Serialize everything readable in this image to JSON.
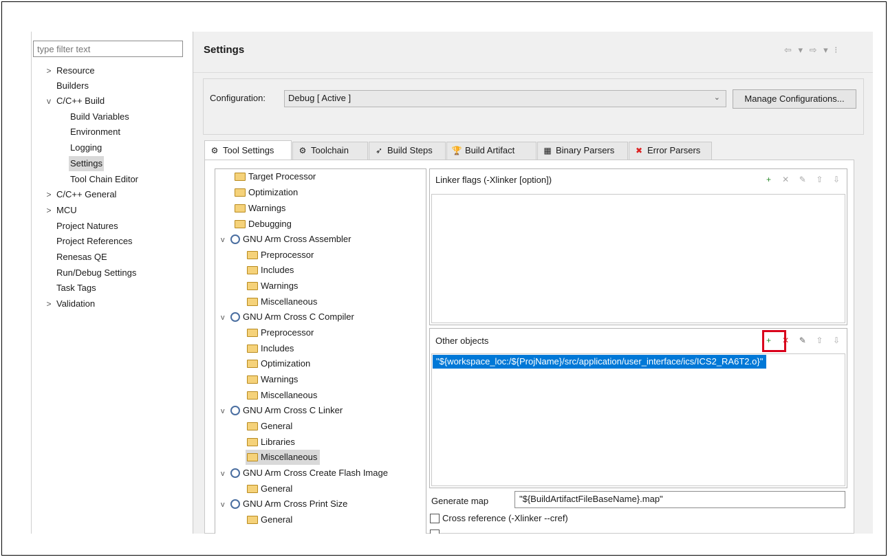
{
  "filter": {
    "placeholder": "type filter text"
  },
  "nav": {
    "items": [
      {
        "label": "Resource",
        "chevron": ">"
      },
      {
        "label": "Builders"
      },
      {
        "label": "C/C++ Build",
        "chevron": "v"
      },
      {
        "label": "Build Variables"
      },
      {
        "label": "Environment"
      },
      {
        "label": "Logging"
      },
      {
        "label": "Settings"
      },
      {
        "label": "Tool Chain Editor"
      },
      {
        "label": "C/C++ General",
        "chevron": ">"
      },
      {
        "label": "MCU",
        "chevron": ">"
      },
      {
        "label": "Project Natures"
      },
      {
        "label": "Project References"
      },
      {
        "label": "Renesas QE"
      },
      {
        "label": "Run/Debug Settings"
      },
      {
        "label": "Task Tags"
      },
      {
        "label": "Validation",
        "chevron": ">"
      }
    ]
  },
  "header": {
    "title": "Settings",
    "arrows": "⇦ ▾ ⇨ ▾ ⁝"
  },
  "config": {
    "label": "Configuration:",
    "value": "Debug  [ Active ]",
    "arrow": "⌄",
    "manage": "Manage Configurations..."
  },
  "tabs": [
    {
      "label": "Tool Settings",
      "icon": "⚙"
    },
    {
      "label": "Toolchain",
      "icon": "⚙"
    },
    {
      "label": "Build Steps",
      "icon": "➶"
    },
    {
      "label": "Build Artifact",
      "icon": "🏆"
    },
    {
      "label": "Binary Parsers",
      "icon": "▦"
    },
    {
      "label": "Error Parsers",
      "icon": "✖"
    }
  ],
  "tool_tree": [
    {
      "label": "Target Processor"
    },
    {
      "label": "Optimization"
    },
    {
      "label": "Warnings"
    },
    {
      "label": "Debugging"
    },
    {
      "label": "GNU Arm Cross Assembler",
      "tw": "v"
    },
    {
      "label": "Preprocessor"
    },
    {
      "label": "Includes"
    },
    {
      "label": "Warnings"
    },
    {
      "label": "Miscellaneous"
    },
    {
      "label": "GNU Arm Cross C Compiler",
      "tw": "v"
    },
    {
      "label": "Preprocessor"
    },
    {
      "label": "Includes"
    },
    {
      "label": "Optimization"
    },
    {
      "label": "Warnings"
    },
    {
      "label": "Miscellaneous"
    },
    {
      "label": "GNU Arm Cross C Linker",
      "tw": "v"
    },
    {
      "label": "General"
    },
    {
      "label": "Libraries"
    },
    {
      "label": "Miscellaneous"
    },
    {
      "label": "GNU Arm Cross Create Flash Image",
      "tw": "v"
    },
    {
      "label": "General"
    },
    {
      "label": "GNU Arm Cross Print Size",
      "tw": "v"
    },
    {
      "label": "General"
    }
  ],
  "linker_flags": {
    "title": "Linker flags (-Xlinker [option])"
  },
  "other_objects": {
    "title": "Other objects",
    "entry": "\"${workspace_loc:/${ProjName}/src/application/user_interface/ics/ICS2_RA6T2.o}\""
  },
  "tool_icons": {
    "add": "+",
    "delete": "✕",
    "edit": "✎",
    "up": "⇧",
    "down": "⇩"
  },
  "generate_map": {
    "label": "Generate map",
    "value": "\"${BuildArtifactFileBaseName}.map\""
  },
  "cross_reference": {
    "label": "Cross reference (-Xlinker --cref)"
  }
}
